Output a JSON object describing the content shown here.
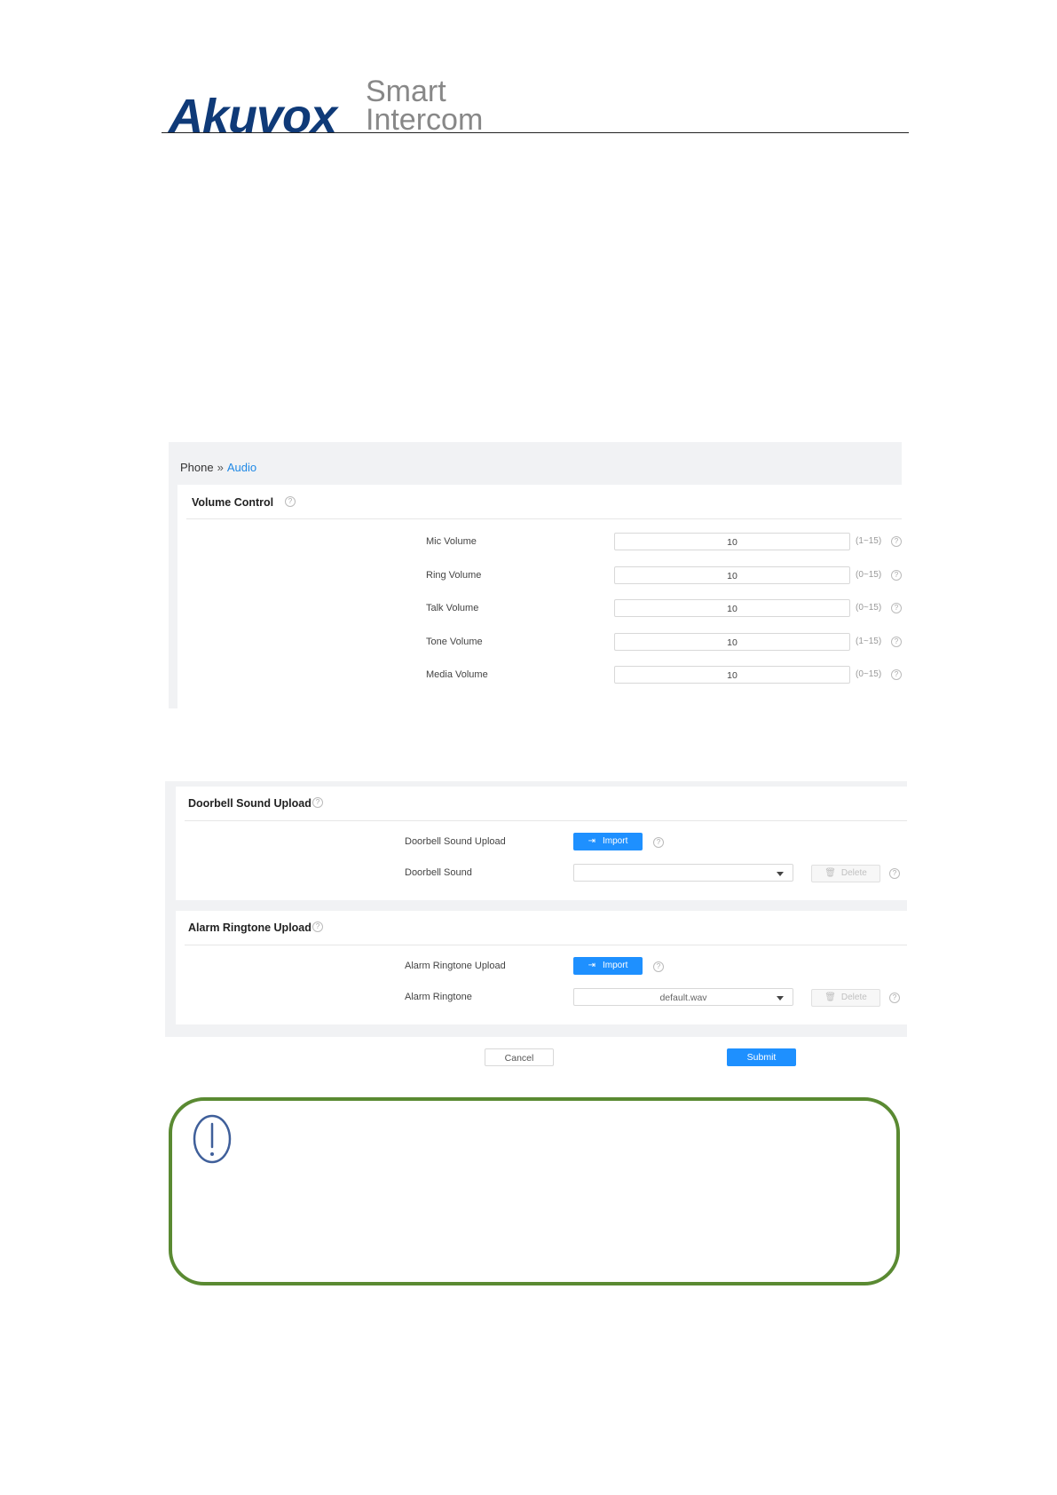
{
  "logo": {
    "brand": "Akuvox",
    "tagline_1": "Smart",
    "tagline_2": "Intercom"
  },
  "breadcrumb": {
    "parent": "Phone",
    "separator": "»",
    "current": "Audio"
  },
  "volume_control": {
    "title": "Volume Control",
    "rows": [
      {
        "label": "Mic Volume",
        "value": "10",
        "range": "(1~15)"
      },
      {
        "label": "Ring Volume",
        "value": "10",
        "range": "(0~15)"
      },
      {
        "label": "Talk Volume",
        "value": "10",
        "range": "(0~15)"
      },
      {
        "label": "Tone Volume",
        "value": "10",
        "range": "(1~15)"
      },
      {
        "label": "Media Volume",
        "value": "10",
        "range": "(0~15)"
      }
    ]
  },
  "doorbell": {
    "title": "Doorbell Sound Upload",
    "upload_label": "Doorbell Sound Upload",
    "import_label": "Import",
    "sound_label": "Doorbell Sound",
    "sound_value": "",
    "delete_label": "Delete"
  },
  "alarm": {
    "title": "Alarm Ringtone Upload",
    "upload_label": "Alarm Ringtone Upload",
    "import_label": "Import",
    "sound_label": "Alarm Ringtone",
    "sound_value": "default.wav",
    "delete_label": "Delete"
  },
  "actions": {
    "cancel": "Cancel",
    "submit": "Submit"
  },
  "colors": {
    "brand": "#0f3a78",
    "accent": "#1e90ff",
    "note_border": "#5a8a32"
  },
  "icons": {
    "help": "help-circle-icon",
    "import": "import-icon",
    "delete": "trash-icon",
    "note": "exclamation-circle-icon"
  }
}
